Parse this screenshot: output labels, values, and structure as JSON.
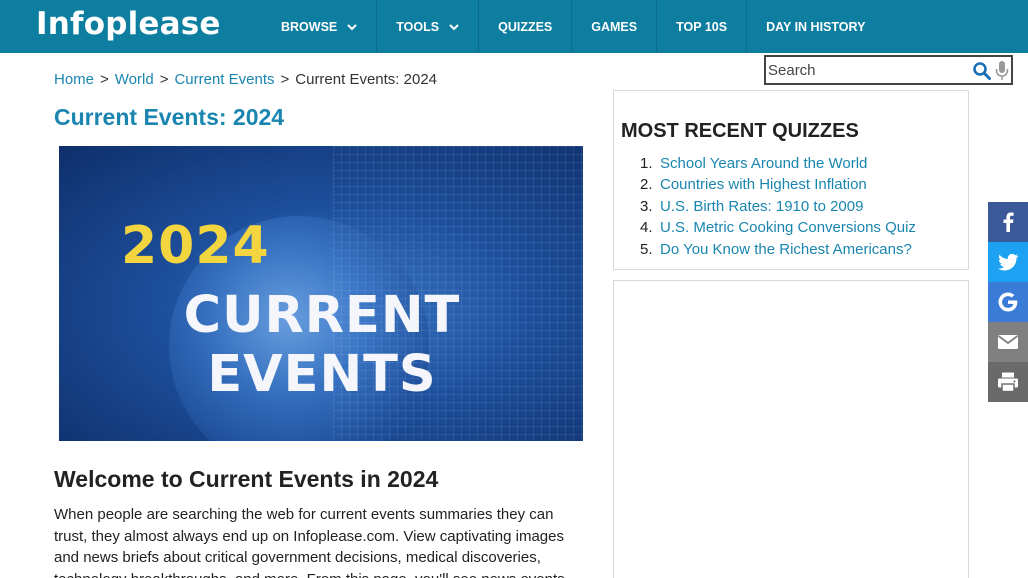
{
  "brand": {
    "logo_text": "Infoplease"
  },
  "nav": {
    "items": [
      {
        "label": "BROWSE",
        "has_dropdown": true
      },
      {
        "label": "TOOLS",
        "has_dropdown": true
      },
      {
        "label": "QUIZZES",
        "has_dropdown": false
      },
      {
        "label": "GAMES",
        "has_dropdown": false
      },
      {
        "label": "TOP 10S",
        "has_dropdown": false
      },
      {
        "label": "DAY IN HISTORY",
        "has_dropdown": false
      }
    ]
  },
  "search": {
    "placeholder": "Search",
    "value": "",
    "search_icon": "magnifier-icon",
    "mic_icon": "microphone-icon"
  },
  "breadcrumb": {
    "items": [
      "Home",
      "World",
      "Current Events"
    ],
    "current": "Current Events: 2024",
    "separator": ">"
  },
  "main": {
    "title": "Current Events: 2024",
    "hero": {
      "year": "2024",
      "headline": "CURRENT EVENTS"
    },
    "section_heading": "Welcome to Current Events in 2024",
    "intro": "When people are searching the web for current events summaries they can trust, they almost always end up on Infoplease.com. View captivating images and news briefs about critical government decisions, medical discoveries, technology breakthroughs, and more. From this page, you'll see news events"
  },
  "sidebar": {
    "quizzes_heading": "MOST RECENT QUIZZES",
    "quizzes": [
      {
        "num": "1.",
        "title": "School Years Around the World"
      },
      {
        "num": "2.",
        "title": "Countries with Highest Inflation"
      },
      {
        "num": "3.",
        "title": "U.S. Birth Rates: 1910 to 2009"
      },
      {
        "num": "4.",
        "title": "U.S. Metric Cooking Conversions Quiz"
      },
      {
        "num": "5.",
        "title": "Do You Know the Richest Americans?"
      }
    ]
  },
  "share": {
    "buttons": [
      {
        "name": "facebook",
        "icon": "facebook-icon",
        "color": "#3b5998"
      },
      {
        "name": "twitter",
        "icon": "twitter-icon",
        "color": "#1da1f2"
      },
      {
        "name": "google",
        "icon": "google-icon",
        "color": "#3b7bd8"
      },
      {
        "name": "email",
        "icon": "email-icon",
        "color": "#808080"
      },
      {
        "name": "print",
        "icon": "print-icon",
        "color": "#6a6a6a"
      }
    ]
  },
  "colors": {
    "header_bg": "#0e7ea0",
    "link": "#1a86b0",
    "hero_year": "#f3d540"
  }
}
